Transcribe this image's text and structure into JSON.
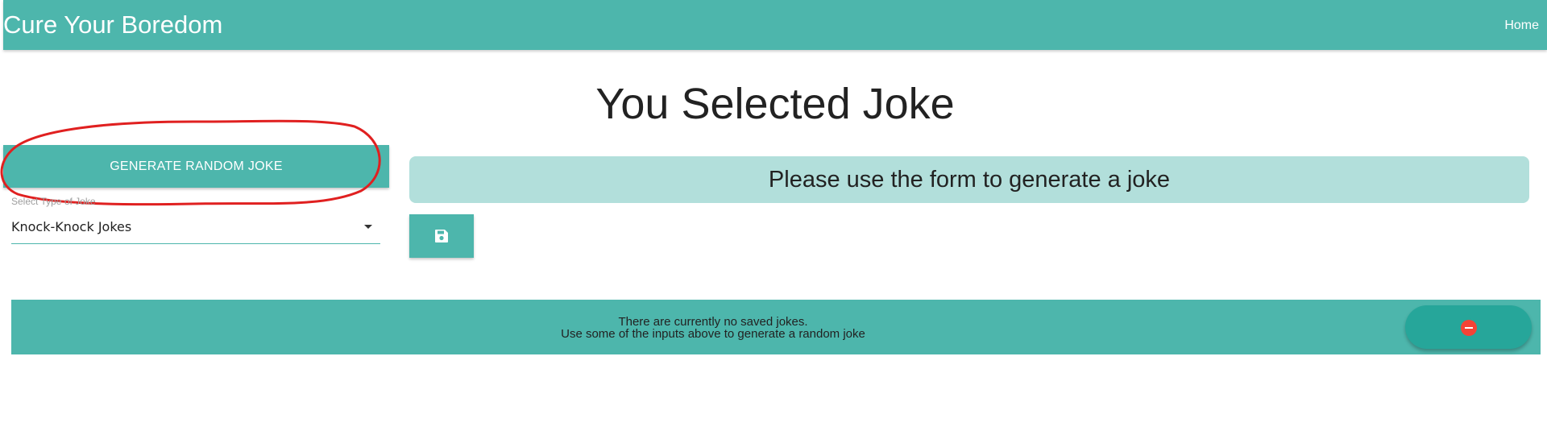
{
  "navbar": {
    "brand": "Cure Your Boredom",
    "home_link": "Home"
  },
  "main": {
    "heading": "You Selected Joke",
    "generate_button": "GENERATE RANDOM JOKE",
    "joke_type": {
      "label": "Select Type of Joke",
      "selected": "Knock-Knock Jokes"
    },
    "joke_display": "Please use the form to generate a joke",
    "save_icon": "floppy-disk-icon"
  },
  "saved_jokes": {
    "line1": "There are currently no saved jokes.",
    "line2": "Use some of the inputs above to generate a random joke",
    "delete_icon": "remove-circle-icon"
  },
  "colors": {
    "primary": "#4db6ac",
    "primary_light": "#b2dfdb",
    "primary_dark": "#26a69a",
    "danger": "#f44336",
    "annotation": "#e02020"
  }
}
